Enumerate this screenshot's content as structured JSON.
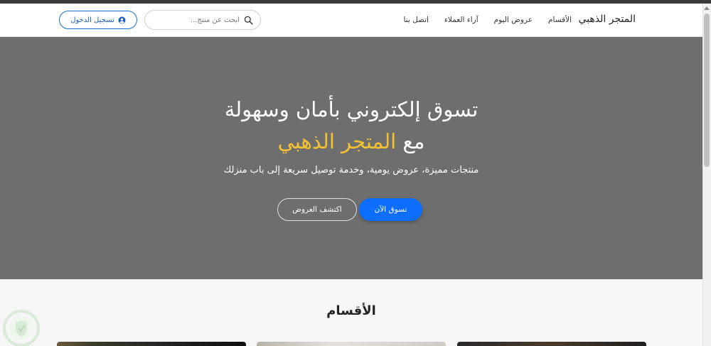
{
  "navbar": {
    "brand": "المتجر الذهبي",
    "links": [
      "الأقسام",
      "عروض اليوم",
      "آراء العملاء",
      "اتصل بنا"
    ],
    "search_placeholder": "ابحث عن منتج...",
    "login_label": "تسجيل الدخول"
  },
  "hero": {
    "title_line1": "تسوق إلكتروني بأمان وسهولة",
    "title_line2_prefix": "مع",
    "title_line2_accent": "المتجر الذهبي",
    "subtitle": "منتجات مميزة، عروض يومية، وخدمة توصيل سريعة إلى باب منزلك",
    "primary_button": "تسوق الآن",
    "secondary_button": "اكتشف العروض"
  },
  "categories": {
    "title": "الأقسام"
  },
  "colors": {
    "accent": "#f2c230",
    "primary": "#0d6efd",
    "hero_bg": "#6e6e6e"
  }
}
